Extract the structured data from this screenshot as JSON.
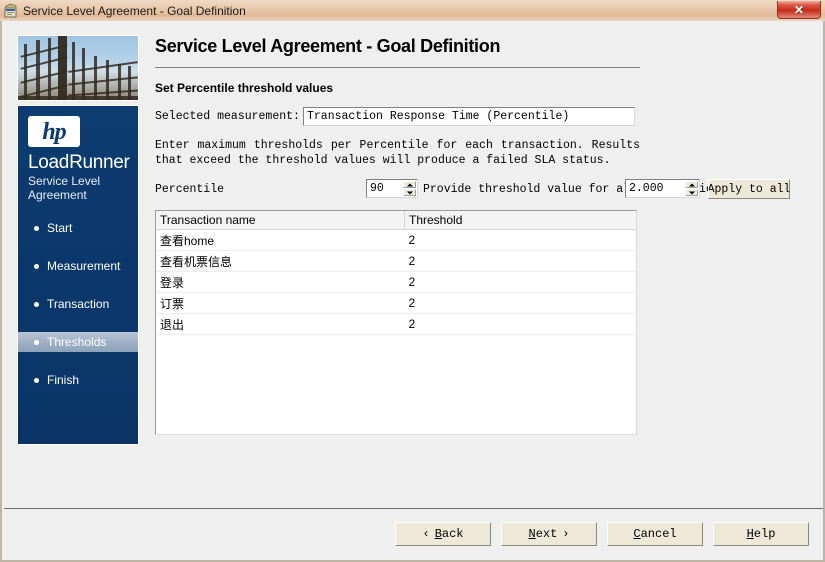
{
  "window": {
    "title": "Service Level Agreement - Goal Definition",
    "icon": "sla-wizard-icon",
    "close_label": "✕"
  },
  "sidebar": {
    "photo_alt": "roller-coaster-photo",
    "brand": "hp",
    "product": "LoadRunner",
    "product_sub": "Service Level Agreement",
    "items": [
      {
        "label": "Start",
        "active": false
      },
      {
        "label": "Measurement",
        "active": false
      },
      {
        "label": "Transaction",
        "active": false
      },
      {
        "label": "Thresholds",
        "active": true
      },
      {
        "label": "Finish",
        "active": false
      }
    ]
  },
  "main": {
    "page_title": "Service Level Agreement - Goal Definition",
    "section_title": "Set Percentile threshold values",
    "measurement_label": "Selected measurement:",
    "measurement_value": "Transaction Response Time (Percentile)",
    "description": "Enter maximum thresholds per Percentile for each transaction. Results that exceed the threshold values will produce a failed SLA status.",
    "percentile_label": "Percentile",
    "percentile_value": "90",
    "provide_label": "Provide threshold value for all transactions",
    "threshold_value": "2.000",
    "apply_label": "Apply to all",
    "table": {
      "columns": [
        "Transaction name",
        "Threshold"
      ],
      "rows": [
        {
          "name": "查看home",
          "threshold": "2"
        },
        {
          "name": "查看机票信息",
          "threshold": "2"
        },
        {
          "name": "登录",
          "threshold": "2"
        },
        {
          "name": "订票",
          "threshold": "2"
        },
        {
          "name": "退出",
          "threshold": "2"
        }
      ]
    }
  },
  "footer": {
    "back": "Back",
    "back_mnemonic": "B",
    "next": "Next",
    "next_mnemonic": "N",
    "cancel": "Cancel",
    "cancel_mnemonic": "C",
    "help": "Help",
    "help_mnemonic": "H",
    "back_arrow": "‹",
    "next_arrow": "›"
  },
  "colors": {
    "titlebar_accent": "#e8c7a9",
    "close_red": "#c62b18",
    "brand_blue": "#0b3a6b",
    "nav_active": "#9fb0c6",
    "window_bg": "#efefef"
  }
}
